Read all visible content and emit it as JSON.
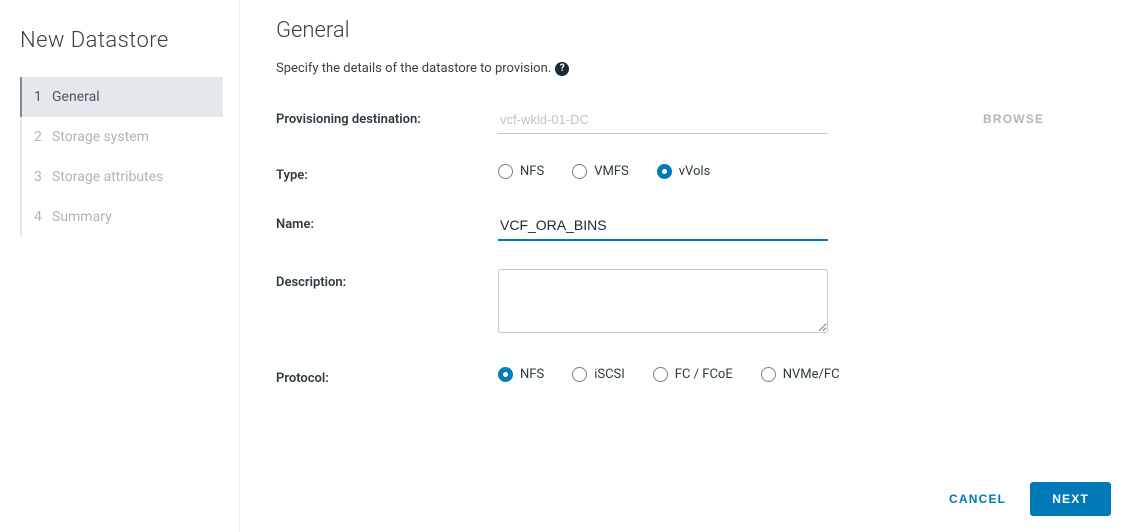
{
  "wizard": {
    "title": "New Datastore",
    "steps": [
      {
        "num": "1",
        "label": "General",
        "active": true
      },
      {
        "num": "2",
        "label": "Storage system",
        "active": false
      },
      {
        "num": "3",
        "label": "Storage attributes",
        "active": false
      },
      {
        "num": "4",
        "label": "Summary",
        "active": false
      }
    ]
  },
  "page": {
    "heading": "General",
    "subtext": "Specify the details of the datastore to provision.",
    "help_symbol": "?"
  },
  "form": {
    "destination": {
      "label": "Provisioning destination:",
      "value": "vcf-wkld-01-DC",
      "browse": "BROWSE"
    },
    "type": {
      "label": "Type:",
      "options": [
        {
          "label": "NFS",
          "selected": false
        },
        {
          "label": "VMFS",
          "selected": false
        },
        {
          "label": "vVols",
          "selected": true
        }
      ]
    },
    "name": {
      "label": "Name:",
      "value": "VCF_ORA_BINS"
    },
    "description": {
      "label": "Description:",
      "value": ""
    },
    "protocol": {
      "label": "Protocol:",
      "options": [
        {
          "label": "NFS",
          "selected": true
        },
        {
          "label": "iSCSI",
          "selected": false
        },
        {
          "label": "FC / FCoE",
          "selected": false
        },
        {
          "label": "NVMe/FC",
          "selected": false
        }
      ]
    }
  },
  "footer": {
    "cancel": "CANCEL",
    "next": "NEXT"
  }
}
